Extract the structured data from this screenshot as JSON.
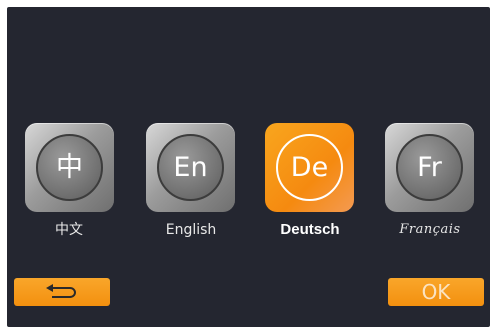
{
  "languages": [
    {
      "code": "中",
      "label": "中文"
    },
    {
      "code": "En",
      "label": "English"
    },
    {
      "code": "De",
      "label": "Deutsch"
    },
    {
      "code": "Fr",
      "label": "Français"
    }
  ],
  "selected_language": "Deutsch",
  "buttons": {
    "back_icon": "return-arrow-icon",
    "ok_label": "OK"
  },
  "colors": {
    "background": "#242630",
    "accent": "#f7941d",
    "inactive_tile": "#9c9c9c"
  }
}
